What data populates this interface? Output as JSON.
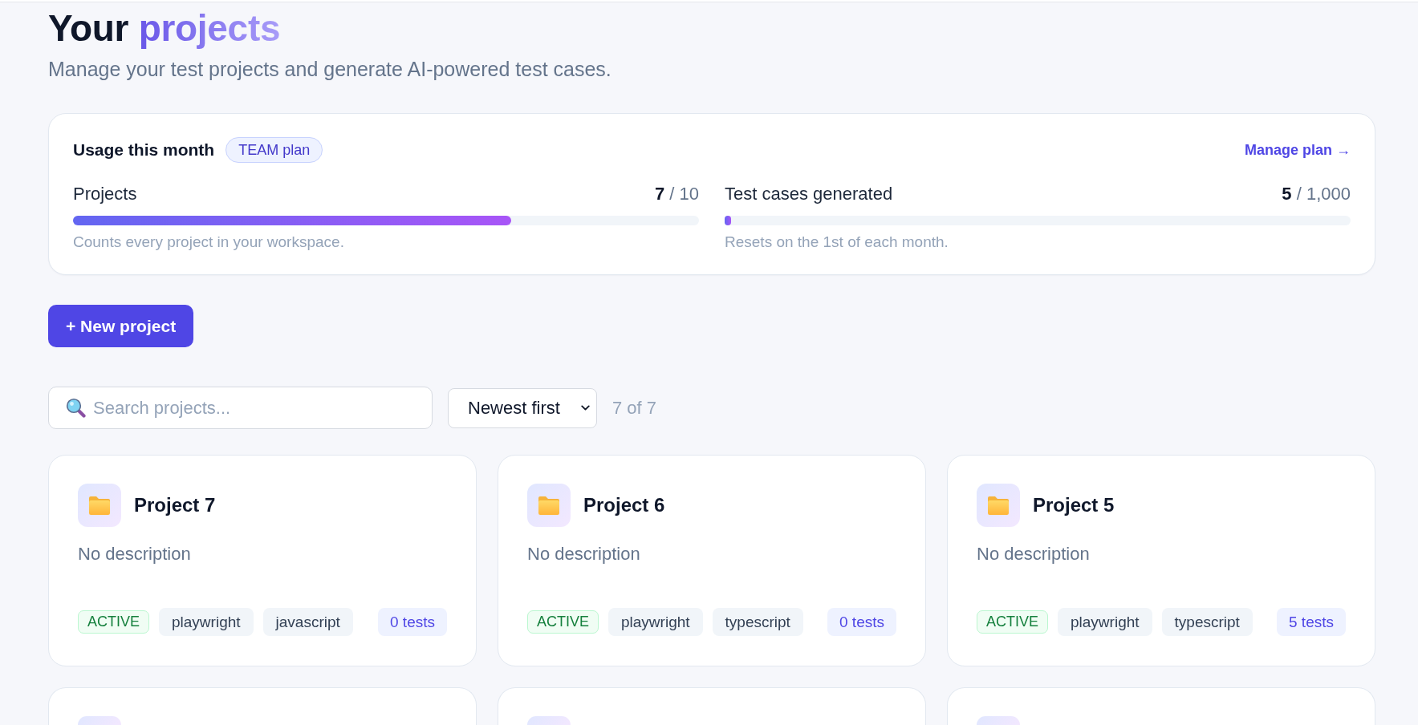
{
  "page_header": {
    "title": "Your",
    "title_highlight": "projects",
    "subtitle": "Manage your test projects and generate AI-powered test cases."
  },
  "usage": {
    "title": "Usage this month",
    "plan_badge": "TEAM plan",
    "manage_link": "Manage plan →",
    "meters": [
      {
        "label": "Projects",
        "count": "**7** / 10",
        "level": 0.7,
        "note": "Counts every project in your workspace."
      },
      {
        "label": "Test cases generated",
        "count": "**5** / 1,000",
        "level": 0.005,
        "note": "Resets on the 1st of each month."
      }
    ]
  },
  "new_project_button": "+ New project",
  "filters": {
    "search": {
      "placeholder": "Search projects..."
    },
    "sort": {
      "value": "Newest first"
    },
    "result_count": "7 of 7"
  },
  "projects": [
    {
      "kind": "card",
      "name": "Project 7",
      "description": "No description",
      "status": "ACTIVE",
      "tags": [
        "playwright",
        "javascript"
      ],
      "tests": "0 tests"
    },
    {
      "kind": "card",
      "name": "Project 6",
      "description": "No description",
      "status": "ACTIVE",
      "tags": [
        "playwright",
        "typescript"
      ],
      "tests": "0 tests"
    },
    {
      "kind": "card",
      "name": "Project 5",
      "description": "No description",
      "status": "ACTIVE",
      "tags": [
        "playwright",
        "typescript"
      ],
      "tests": "5 tests"
    },
    {
      "kind": "cut-off"
    },
    {
      "kind": "cut-off"
    },
    {
      "kind": "cut-off"
    }
  ]
}
